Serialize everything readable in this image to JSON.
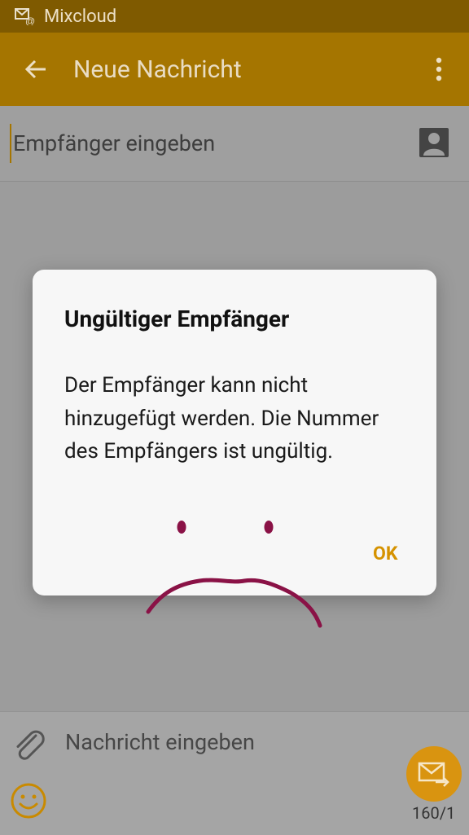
{
  "status_bar": {
    "app_name": "Mixcloud",
    "notification_icon": "mail-at-icon"
  },
  "app_bar": {
    "title": "Neue Nachricht",
    "back_icon": "arrow-left-icon",
    "menu_icon": "more-vert-icon"
  },
  "recipient": {
    "placeholder": "Empfänger eingeben",
    "value": "",
    "contact_icon": "contact-icon"
  },
  "compose": {
    "message_placeholder": "Nachricht eingeben",
    "attach_icon": "paperclip-icon",
    "emoji_icon": "smiley-icon",
    "send_icon": "send-mail-icon",
    "char_count": "160/1"
  },
  "dialog": {
    "title": "Ungültiger Empfänger",
    "message": "Der Empfänger kann nicht hinzugefügt werden. Die Nummer des Empfängers ist ungültig.",
    "ok_label": "OK"
  },
  "colors": {
    "accent": "#a57500",
    "status_bar": "#7f5a00",
    "ok_text": "#d59200",
    "send_button": "#d99410",
    "doodle": "#8a1246"
  }
}
